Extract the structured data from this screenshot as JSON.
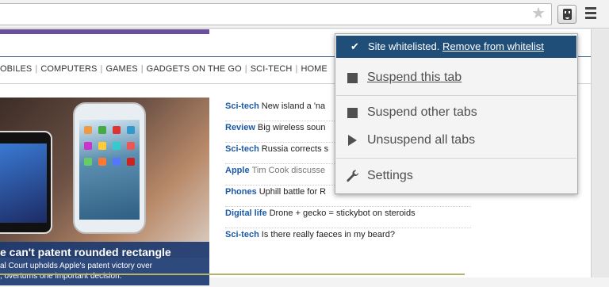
{
  "nav": {
    "items": [
      "OBILES",
      "COMPUTERS",
      "GAMES",
      "GADGETS ON THE GO",
      "SCI-TECH",
      "HOME"
    ],
    "separator": "|"
  },
  "hero": {
    "title": "e can't patent rounded rectangle",
    "subtitle_line1": "al   Court upholds Apple's patent victory over",
    "subtitle_line2": ", overturns one important decision."
  },
  "headlines": [
    {
      "category": "Sci-tech",
      "text": "New island a 'na",
      "extra": ""
    },
    {
      "category": "Review",
      "text": "Big wireless soun",
      "extra": ""
    },
    {
      "category": "Sci-tech",
      "text": "Russia corrects s",
      "extra": ""
    },
    {
      "category": "Apple",
      "text": "",
      "extra": "Tim Cook discusse"
    },
    {
      "category": "Phones",
      "text": "Uphill battle for R",
      "extra": ""
    },
    {
      "category": "Digital life",
      "text": "Drone + gecko = stickybot on steroids",
      "extra": ""
    },
    {
      "category": "Sci-tech",
      "text": "Is there really faeces in my beard?",
      "extra": ""
    }
  ],
  "popup": {
    "status_text": "Site whitelisted.",
    "status_link": "Remove from whitelist",
    "items": [
      {
        "label": "Suspend this tab",
        "icon": "stop-square-icon"
      },
      {
        "label": "Suspend other tabs",
        "icon": "stop-square-icon"
      },
      {
        "label": "Unsuspend all tabs",
        "icon": "play-triangle-icon"
      },
      {
        "label": "Settings",
        "icon": "wrench-icon"
      }
    ]
  },
  "colors": {
    "popup_header": "#1f4e79",
    "accent_purple": "#6b4fa0",
    "category_blue": "#1d5aa6"
  }
}
